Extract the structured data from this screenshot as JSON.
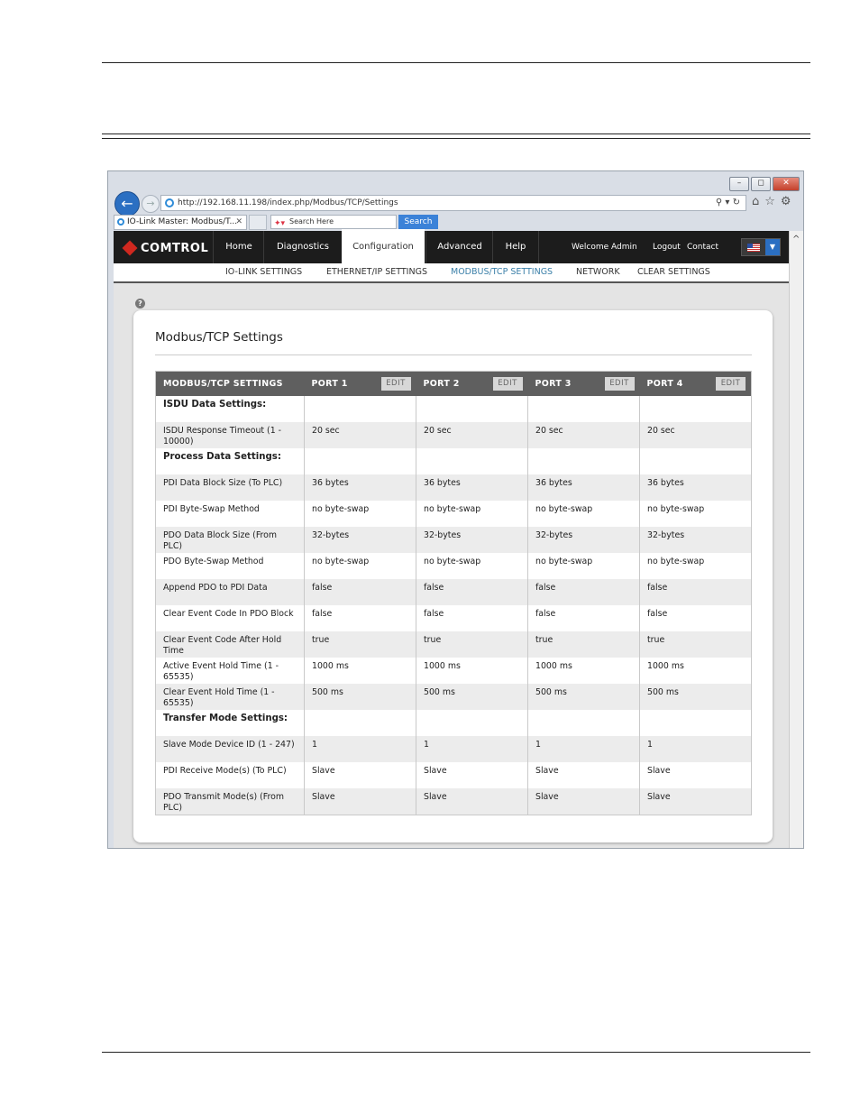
{
  "browser": {
    "url": "http://192.168.11.198/index.php/Modbus/TCP/Settings",
    "address_tools": "⚲ ▾ ↻",
    "tab_title": "IO-Link Master: Modbus/T...",
    "search_placeholder": "Search Here",
    "search_button": "Search",
    "window_buttons": [
      "–",
      "◻",
      "✕"
    ]
  },
  "app_nav": {
    "logo": "COMTROL",
    "items": [
      "Home",
      "Diagnostics",
      "Configuration",
      "Advanced",
      "Help"
    ],
    "active": "Configuration",
    "welcome": "Welcome Admin",
    "logout": "Logout",
    "contact": "Contact"
  },
  "sub_nav": {
    "items": [
      "IO-LINK SETTINGS",
      "ETHERNET/IP SETTINGS",
      "MODBUS/TCP SETTINGS",
      "NETWORK",
      "CLEAR SETTINGS"
    ],
    "active": "MODBUS/TCP SETTINGS"
  },
  "page": {
    "help_glyph": "?",
    "title": "Modbus/TCP Settings",
    "table": {
      "header": [
        "MODBUS/TCP SETTINGS",
        "PORT 1",
        "PORT 2",
        "PORT 3",
        "PORT 4"
      ],
      "edit_label": "EDIT",
      "rows": [
        [
          "ISDU Data Settings:",
          "",
          "",
          "",
          ""
        ],
        [
          "ISDU Response Timeout (1 - 10000)",
          "20 sec",
          "20 sec",
          "20 sec",
          "20 sec"
        ],
        [
          "Process Data Settings:",
          "",
          "",
          "",
          ""
        ],
        [
          "PDI Data Block Size (To PLC)",
          "36 bytes",
          "36 bytes",
          "36 bytes",
          "36 bytes"
        ],
        [
          "PDI Byte-Swap Method",
          "no byte-swap",
          "no byte-swap",
          "no byte-swap",
          "no byte-swap"
        ],
        [
          "PDO Data Block Size (From PLC)",
          "32-bytes",
          "32-bytes",
          "32-bytes",
          "32-bytes"
        ],
        [
          "PDO Byte-Swap Method",
          "no byte-swap",
          "no byte-swap",
          "no byte-swap",
          "no byte-swap"
        ],
        [
          "Append PDO to PDI Data",
          "false",
          "false",
          "false",
          "false"
        ],
        [
          "Clear Event Code In PDO Block",
          "false",
          "false",
          "false",
          "false"
        ],
        [
          "Clear Event Code After Hold Time",
          "true",
          "true",
          "true",
          "true"
        ],
        [
          "Active Event Hold Time (1 - 65535)",
          "1000 ms",
          "1000 ms",
          "1000 ms",
          "1000 ms"
        ],
        [
          "Clear Event Hold Time (1 - 65535)",
          "500 ms",
          "500 ms",
          "500 ms",
          "500 ms"
        ],
        [
          "Transfer Mode Settings:",
          "",
          "",
          "",
          ""
        ],
        [
          "Slave Mode Device ID (1 - 247)",
          "1",
          "1",
          "1",
          "1"
        ],
        [
          "PDI Receive Mode(s) (To PLC)",
          "Slave",
          "Slave",
          "Slave",
          "Slave"
        ],
        [
          "PDO Transmit Mode(s) (From PLC)",
          "Slave",
          "Slave",
          "Slave",
          "Slave"
        ]
      ],
      "section_rows": [
        0,
        2,
        12
      ]
    }
  }
}
